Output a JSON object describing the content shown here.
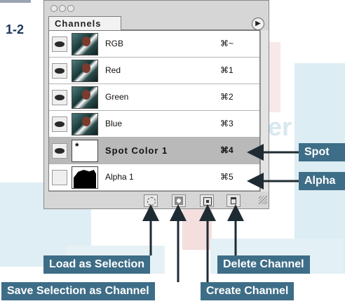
{
  "figure": {
    "label": "1-2"
  },
  "watermark": "Proper",
  "palette": {
    "tab_label": "Channels",
    "channels": [
      {
        "name": "RGB",
        "shortcut": "⌘~",
        "visible": true,
        "selected": false
      },
      {
        "name": "Red",
        "shortcut": "⌘1",
        "visible": true,
        "selected": false
      },
      {
        "name": "Green",
        "shortcut": "⌘2",
        "visible": true,
        "selected": false
      },
      {
        "name": "Blue",
        "shortcut": "⌘3",
        "visible": true,
        "selected": false
      },
      {
        "name": "Spot Color 1",
        "shortcut": "⌘4",
        "visible": true,
        "selected": true
      },
      {
        "name": "Alpha 1",
        "shortcut": "⌘5",
        "visible": false,
        "selected": false
      }
    ]
  },
  "callouts": {
    "spot": "Spot",
    "alpha": "Alpha",
    "load_selection": "Load as Selection",
    "save_selection": "Save Selection as Channel",
    "delete_channel": "Delete Channel",
    "create_channel": "Create Channel"
  },
  "colors": {
    "callout_bg": "#3e6d87",
    "selected_row": "#b9b9b9"
  }
}
